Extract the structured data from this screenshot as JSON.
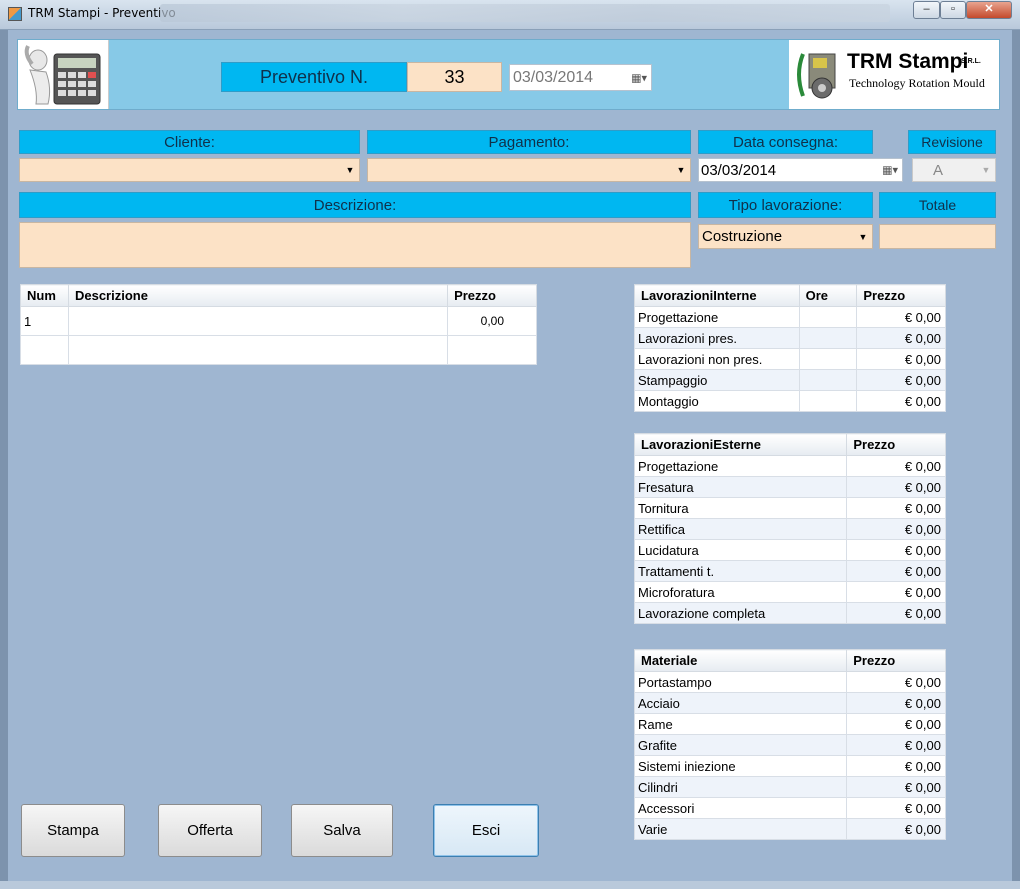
{
  "window": {
    "title": "TRM Stampi - Preventivo",
    "controls": {
      "minimize": "‒",
      "maximize": "▫",
      "close": "✕"
    }
  },
  "header": {
    "preventivo_label": "Preventivo N.",
    "preventivo_number": "33",
    "preventivo_date": "03/03/2014",
    "logo": {
      "brand": "TRM Stampi",
      "suffix": "S.R.L.",
      "tagline": "Technology Rotation Mould"
    }
  },
  "form": {
    "cliente_label": "Cliente:",
    "cliente_value": "",
    "pagamento_label": "Pagamento:",
    "pagamento_value": "",
    "data_consegna_label": "Data consegna:",
    "data_consegna_value": "03/03/2014",
    "revisione_label": "Revisione",
    "revisione_value": "A",
    "descrizione_label": "Descrizione:",
    "descrizione_value": "",
    "tipo_lavorazione_label": "Tipo lavorazione:",
    "tipo_lavorazione_value": "Costruzione",
    "totale_label": "Totale",
    "totale_value": ""
  },
  "items_grid": {
    "headers": [
      "Num",
      "Descrizione",
      "Prezzo"
    ],
    "rows": [
      {
        "num": "1",
        "descrizione": "",
        "prezzo": "0,00"
      },
      {
        "num": "",
        "descrizione": "",
        "prezzo": ""
      }
    ]
  },
  "lavorazioni_interne": {
    "headers": [
      "LavorazioniInterne",
      "Ore",
      "Prezzo"
    ],
    "rows": [
      {
        "name": "Progettazione",
        "ore": "",
        "prezzo": "€ 0,00"
      },
      {
        "name": "Lavorazioni pres.",
        "ore": "",
        "prezzo": "€ 0,00"
      },
      {
        "name": "Lavorazioni non pres.",
        "ore": "",
        "prezzo": "€ 0,00"
      },
      {
        "name": "Stampaggio",
        "ore": "",
        "prezzo": "€ 0,00"
      },
      {
        "name": "Montaggio",
        "ore": "",
        "prezzo": "€ 0,00"
      }
    ]
  },
  "lavorazioni_esterne": {
    "headers": [
      "LavorazioniEsterne",
      "Prezzo"
    ],
    "rows": [
      {
        "name": "Progettazione",
        "prezzo": "€ 0,00"
      },
      {
        "name": "Fresatura",
        "prezzo": "€ 0,00"
      },
      {
        "name": "Tornitura",
        "prezzo": "€ 0,00"
      },
      {
        "name": "Rettifica",
        "prezzo": "€ 0,00"
      },
      {
        "name": "Lucidatura",
        "prezzo": "€ 0,00"
      },
      {
        "name": "Trattamenti t.",
        "prezzo": "€ 0,00"
      },
      {
        "name": "Microforatura",
        "prezzo": "€ 0,00"
      },
      {
        "name": "Lavorazione completa",
        "prezzo": "€ 0,00"
      }
    ]
  },
  "materiale": {
    "headers": [
      "Materiale",
      "Prezzo"
    ],
    "rows": [
      {
        "name": "Portastampo",
        "prezzo": "€ 0,00"
      },
      {
        "name": "Acciaio",
        "prezzo": "€ 0,00"
      },
      {
        "name": "Rame",
        "prezzo": "€ 0,00"
      },
      {
        "name": "Grafite",
        "prezzo": "€ 0,00"
      },
      {
        "name": "Sistemi iniezione",
        "prezzo": "€ 0,00"
      },
      {
        "name": "Cilindri",
        "prezzo": "€ 0,00"
      },
      {
        "name": "Accessori",
        "prezzo": "€ 0,00"
      },
      {
        "name": "Varie",
        "prezzo": "€ 0,00"
      }
    ]
  },
  "buttons": {
    "stampa": "Stampa",
    "offerta": "Offerta",
    "salva": "Salva",
    "esci": "Esci"
  },
  "colors": {
    "client_bg": "#9fb6d1",
    "label_cyan": "#00b7f1",
    "field_peach": "#fce2c6",
    "header_panel": "#87c9e7"
  },
  "icons": {
    "app": "app-icon",
    "calculator": "calculator-man-icon",
    "calendar": "calendar-dropdown-icon",
    "dropdown": "chevron-down-icon",
    "logo": "trm-gear-logo-icon"
  }
}
